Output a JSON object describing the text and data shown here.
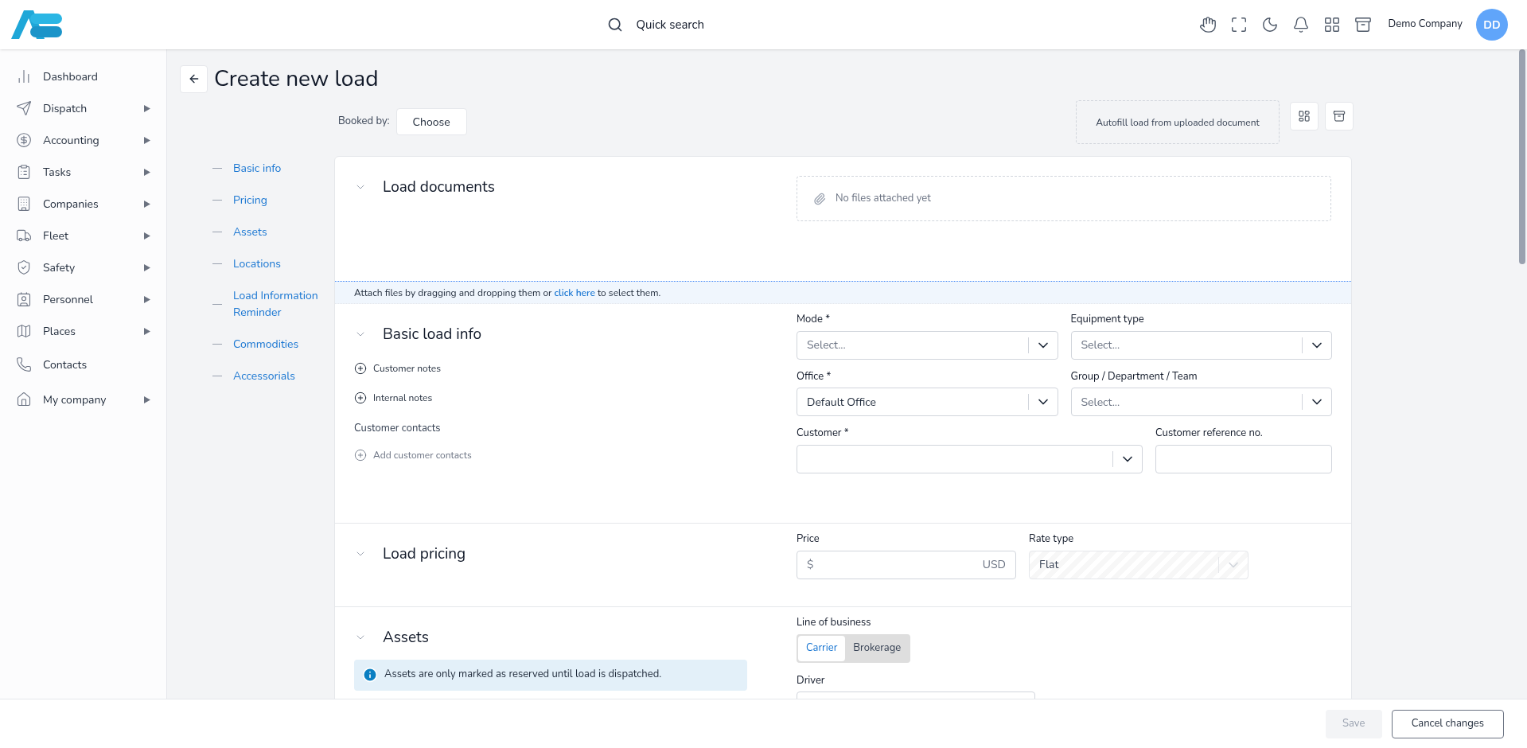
{
  "header": {
    "search_label": "Quick search",
    "company": "Demo Company",
    "avatar": "DD"
  },
  "sidebar": {
    "items": [
      {
        "label": "Dashboard",
        "has_submenu": false
      },
      {
        "label": "Dispatch",
        "has_submenu": true
      },
      {
        "label": "Accounting",
        "has_submenu": true
      },
      {
        "label": "Tasks",
        "has_submenu": true
      },
      {
        "label": "Companies",
        "has_submenu": true
      },
      {
        "label": "Fleet",
        "has_submenu": true
      },
      {
        "label": "Safety",
        "has_submenu": true
      },
      {
        "label": "Personnel",
        "has_submenu": true
      },
      {
        "label": "Places",
        "has_submenu": true
      },
      {
        "label": "Contacts",
        "has_submenu": false
      },
      {
        "label": "My company",
        "has_submenu": true
      }
    ]
  },
  "page": {
    "title": "Create new load",
    "booked_by_label": "Booked by:",
    "booked_by_button": "Choose",
    "autofill": "Autofill load from uploaded document"
  },
  "section_nav": [
    "Basic info",
    "Pricing",
    "Assets",
    "Locations",
    "Load Information Reminder",
    "Commodities",
    "Accessorials"
  ],
  "load_documents": {
    "title": "Load documents",
    "empty": "No files attached yet",
    "attach_before": "Attach files by dragging and dropping them or",
    "attach_link": "click here",
    "attach_after": "to select them."
  },
  "basic_load_info": {
    "title": "Basic load info",
    "note_actions": [
      "Customer notes",
      "Internal notes"
    ],
    "contacts_label": "Customer contacts",
    "add_contacts": "Add customer contacts",
    "fields": [
      {
        "label": "Mode *",
        "kind": "select",
        "placeholder": "Select..."
      },
      {
        "label": "Equipment type",
        "kind": "select",
        "placeholder": "Select..."
      },
      {
        "label": "Office *",
        "kind": "select",
        "value": "Default Office"
      },
      {
        "label": "Group / Department / Team",
        "kind": "select",
        "placeholder": "Select..."
      },
      {
        "label": "Customer *",
        "kind": "select"
      },
      {
        "label": "Customer reference no.",
        "kind": "text"
      }
    ]
  },
  "load_pricing": {
    "title": "Load pricing",
    "price_label": "Price",
    "price_prefix": "$",
    "price_currency": "USD",
    "rate_label": "Rate type",
    "rate_value": "Flat",
    "rate_disabled": true
  },
  "assets": {
    "title": "Assets",
    "info": "Assets are only marked as reserved until load is dispatched.",
    "line_label": "Line of business",
    "line_options": [
      {
        "label": "Carrier",
        "selected": true
      },
      {
        "label": "Brokerage",
        "selected": false
      }
    ],
    "driver_label": "Driver"
  },
  "footer": {
    "save": "Save",
    "save_disabled": true,
    "cancel": "Cancel changes"
  }
}
